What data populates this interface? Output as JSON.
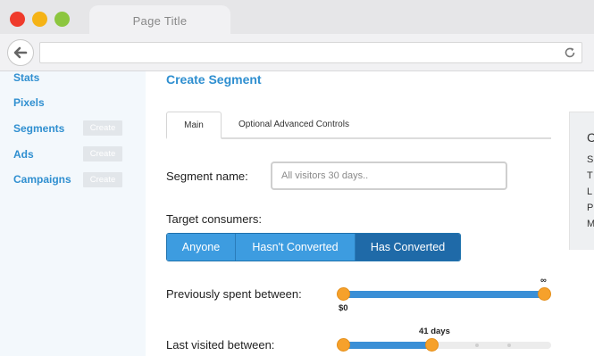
{
  "browser": {
    "tab_title": "Page Title",
    "icons": [
      "back-arrow-icon",
      "reload-icon"
    ]
  },
  "sidebar": {
    "items": [
      {
        "label": "Stats"
      },
      {
        "label": "Pixels"
      },
      {
        "label": "Segments",
        "create_label": "Create"
      },
      {
        "label": "Ads",
        "create_label": "Create"
      },
      {
        "label": "Campaigns",
        "create_label": "Create"
      }
    ]
  },
  "main": {
    "title": "Create Segment",
    "tabs": [
      {
        "label": "Main",
        "active": true
      },
      {
        "label": "Optional Advanced Controls",
        "active": false
      }
    ],
    "segment_name": {
      "label": "Segment name:",
      "placeholder": "All visitors 30 days..",
      "value": ""
    },
    "target": {
      "label": "Target consumers:",
      "options": [
        "Anyone",
        "Hasn't Converted",
        "Has Converted"
      ],
      "selected": "Has Converted"
    },
    "spent": {
      "label": "Previously spent between:",
      "min_label": "$0",
      "max_label": "∞",
      "range": [
        0,
        1
      ]
    },
    "visited": {
      "label": "Last visited between:",
      "value_label": "41 days",
      "range": [
        0,
        0.44
      ]
    }
  },
  "right_panel": {
    "title": "C",
    "items": [
      "S",
      "T",
      "L",
      "P",
      "M"
    ]
  },
  "colors": {
    "accent": "#2f8fd0",
    "active_segment": "#1f6aa8",
    "knob": "#f6a12b"
  }
}
